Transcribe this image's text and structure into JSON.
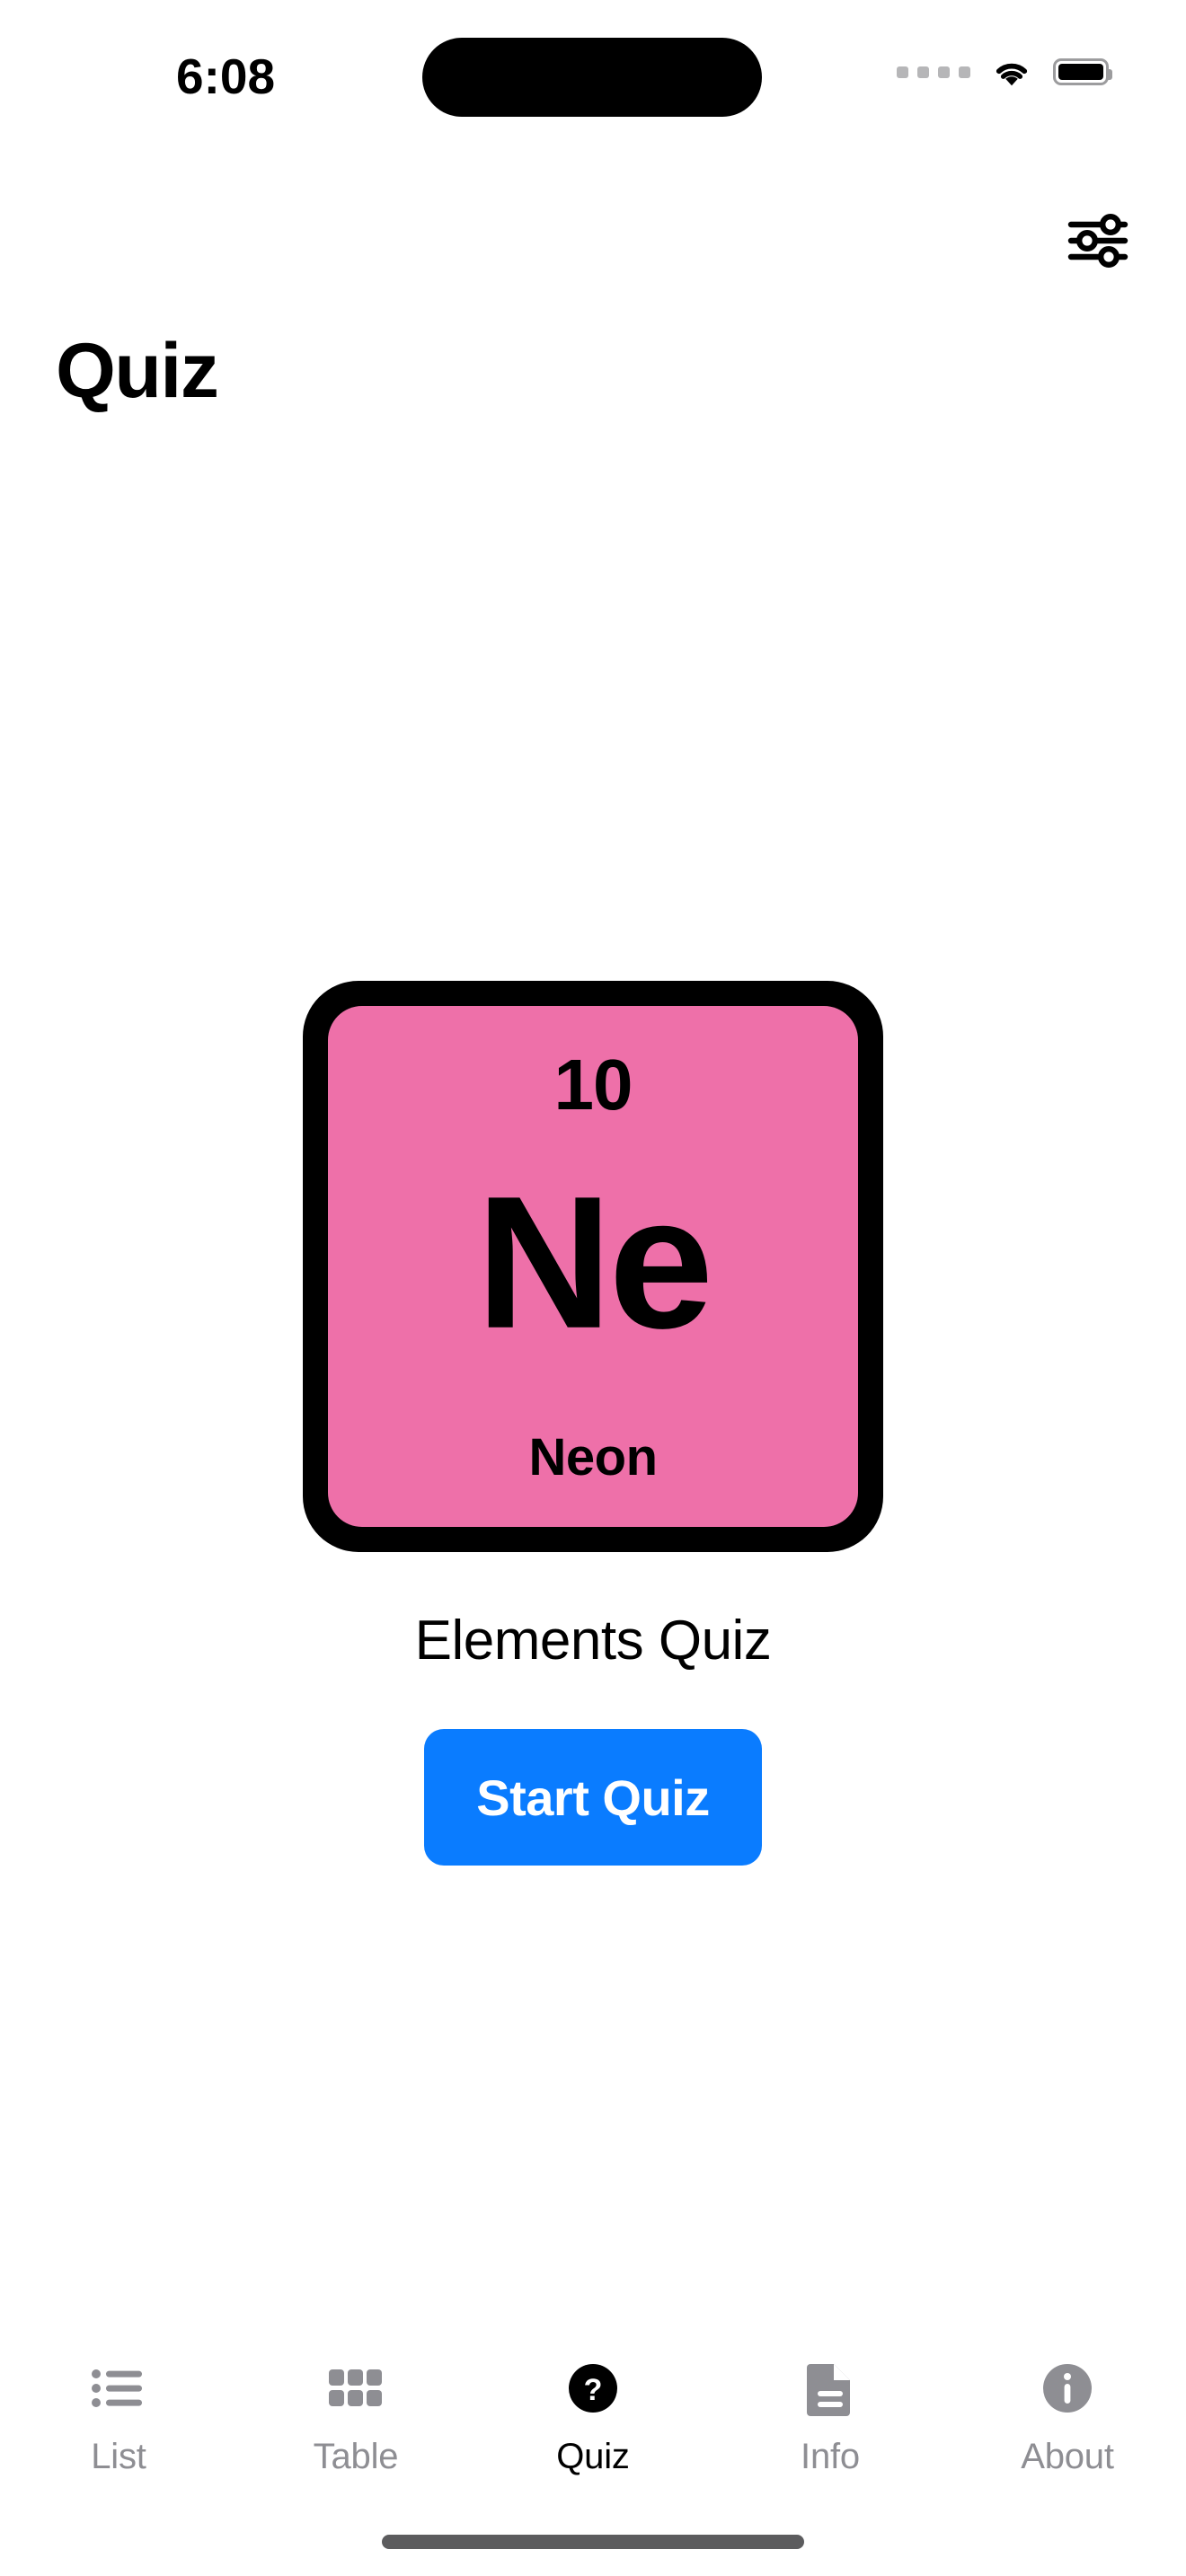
{
  "status_bar": {
    "time": "6:08",
    "cellular_icon": "cellular-dots-icon",
    "cellular_dots": 4,
    "wifi_icon": "wifi-icon",
    "battery_icon": "battery-full-icon",
    "battery_level_percent": 100
  },
  "nav": {
    "settings_icon": "sliders-settings-icon"
  },
  "header": {
    "title": "Quiz"
  },
  "element_card": {
    "atomic_number": "10",
    "symbol": "Ne",
    "name": "Neon",
    "background_color": "#ee70a9",
    "border_color": "#000000"
  },
  "quiz": {
    "label": "Elements Quiz",
    "start_button": "Start Quiz",
    "start_button_color": "#0a7cff"
  },
  "tabbar": {
    "active_index": 2,
    "active_color": "#000000",
    "inactive_color": "#8e8e93",
    "items": [
      {
        "label": "List",
        "icon": "list-bullet-icon"
      },
      {
        "label": "Table",
        "icon": "grid-squares-icon"
      },
      {
        "label": "Quiz",
        "icon": "question-mark-circle-fill-icon"
      },
      {
        "label": "Info",
        "icon": "document-text-icon"
      },
      {
        "label": "About",
        "icon": "info-circle-fill-icon"
      }
    ]
  },
  "home_indicator": {
    "color": "#5c5c5e"
  }
}
